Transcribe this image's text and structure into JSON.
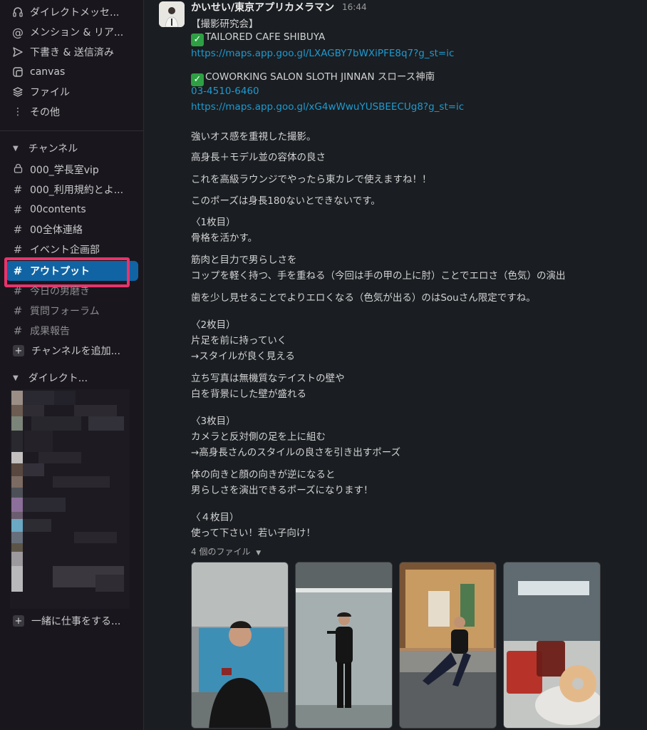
{
  "sidebar": {
    "nav": [
      {
        "label": "ダイレクトメッセ...",
        "icon": "headset-icon"
      },
      {
        "label": "メンション & リア...",
        "icon": "at-icon"
      },
      {
        "label": "下書き & 送信済み",
        "icon": "send-icon"
      },
      {
        "label": "canvas",
        "icon": "canvas-icon"
      },
      {
        "label": "ファイル",
        "icon": "layers-icon"
      },
      {
        "label": "その他",
        "icon": "more-icon"
      }
    ],
    "channels_header": "チャンネル",
    "channels": [
      {
        "label": "000_学長室vip",
        "prefix": "lock"
      },
      {
        "label": "000_利用規約とよ...",
        "prefix": "#"
      },
      {
        "label": "00contents",
        "prefix": "#"
      },
      {
        "label": "00全体連絡",
        "prefix": "#"
      },
      {
        "label": "イベント企画部",
        "prefix": "#"
      },
      {
        "label": "アウトプット",
        "prefix": "#",
        "active": true
      },
      {
        "label": "今日の男磨き",
        "prefix": "#"
      },
      {
        "label": "質問フォーラム",
        "prefix": "#"
      },
      {
        "label": "成果報告",
        "prefix": "#"
      }
    ],
    "add_channel": "チャンネルを追加...",
    "dm_header": "ダイレクト...",
    "invite": "一緒に仕事をする...",
    "colors": {
      "active_bg": "#1164a3",
      "highlight": "#e8336b"
    }
  },
  "message": {
    "author": "かいせい/東京アプリカメラマン",
    "time": "16:44",
    "lines": [
      {
        "text": "【撮影研究会】"
      },
      {
        "text": "TAILORED CAFE SHIBUYA",
        "check": true
      },
      {
        "text": "https://maps.app.goo.gl/LXAGBY7bWXiPFE8q7?g_st=ic",
        "link": true
      },
      {
        "text": "COWORKING SALON SLOTH JINNAN スロース神南",
        "check": true
      },
      {
        "text": "03-4510-6460",
        "link": true
      },
      {
        "text": "https://maps.app.goo.gl/xG4wWwuYUSBEECUg8?g_st=ic",
        "link": true
      },
      {
        "text": "強いオス感を重視した撮影。"
      },
      {
        "text": "高身長＋モデル並の容体の良さ"
      },
      {
        "text": "これを高級ラウンジでやったら東カレで使えますね！！"
      },
      {
        "text": "このポーズは身長180ないとできないです。"
      },
      {
        "text": "〈1枚目）"
      },
      {
        "text": "骨格を活かす。"
      },
      {
        "text": "筋肉と目力で男らしさを"
      },
      {
        "text": "コップを軽く持つ、手を重ねる（今回は手の甲の上に肘）ことでエロさ（色気）の演出"
      },
      {
        "text": "歯を少し見せることでよりエロくなる（色気が出る）のはSouさん限定ですね。"
      },
      {
        "text": "〈2枚目）"
      },
      {
        "text": "片足を前に持っていく"
      },
      {
        "text": "→スタイルが良く見える"
      },
      {
        "text": "立ち写真は無機質なテイストの壁や"
      },
      {
        "text": "白を背景にした壁が盛れる"
      },
      {
        "text": "〈3枚目）"
      },
      {
        "text": "カメラと反対側の足を上に組む"
      },
      {
        "text": "→高身長さんのスタイルの良さを引き出すポーズ"
      },
      {
        "text": "体の向きと顔の向きが逆になると"
      },
      {
        "text": "男らしさを演出できるポーズになります！"
      },
      {
        "text": "〈４枚目）"
      },
      {
        "text": "使って下さい！若い子向け！"
      }
    ],
    "files_label": "4 個のファイル",
    "link_color": "#1d9bd1"
  }
}
